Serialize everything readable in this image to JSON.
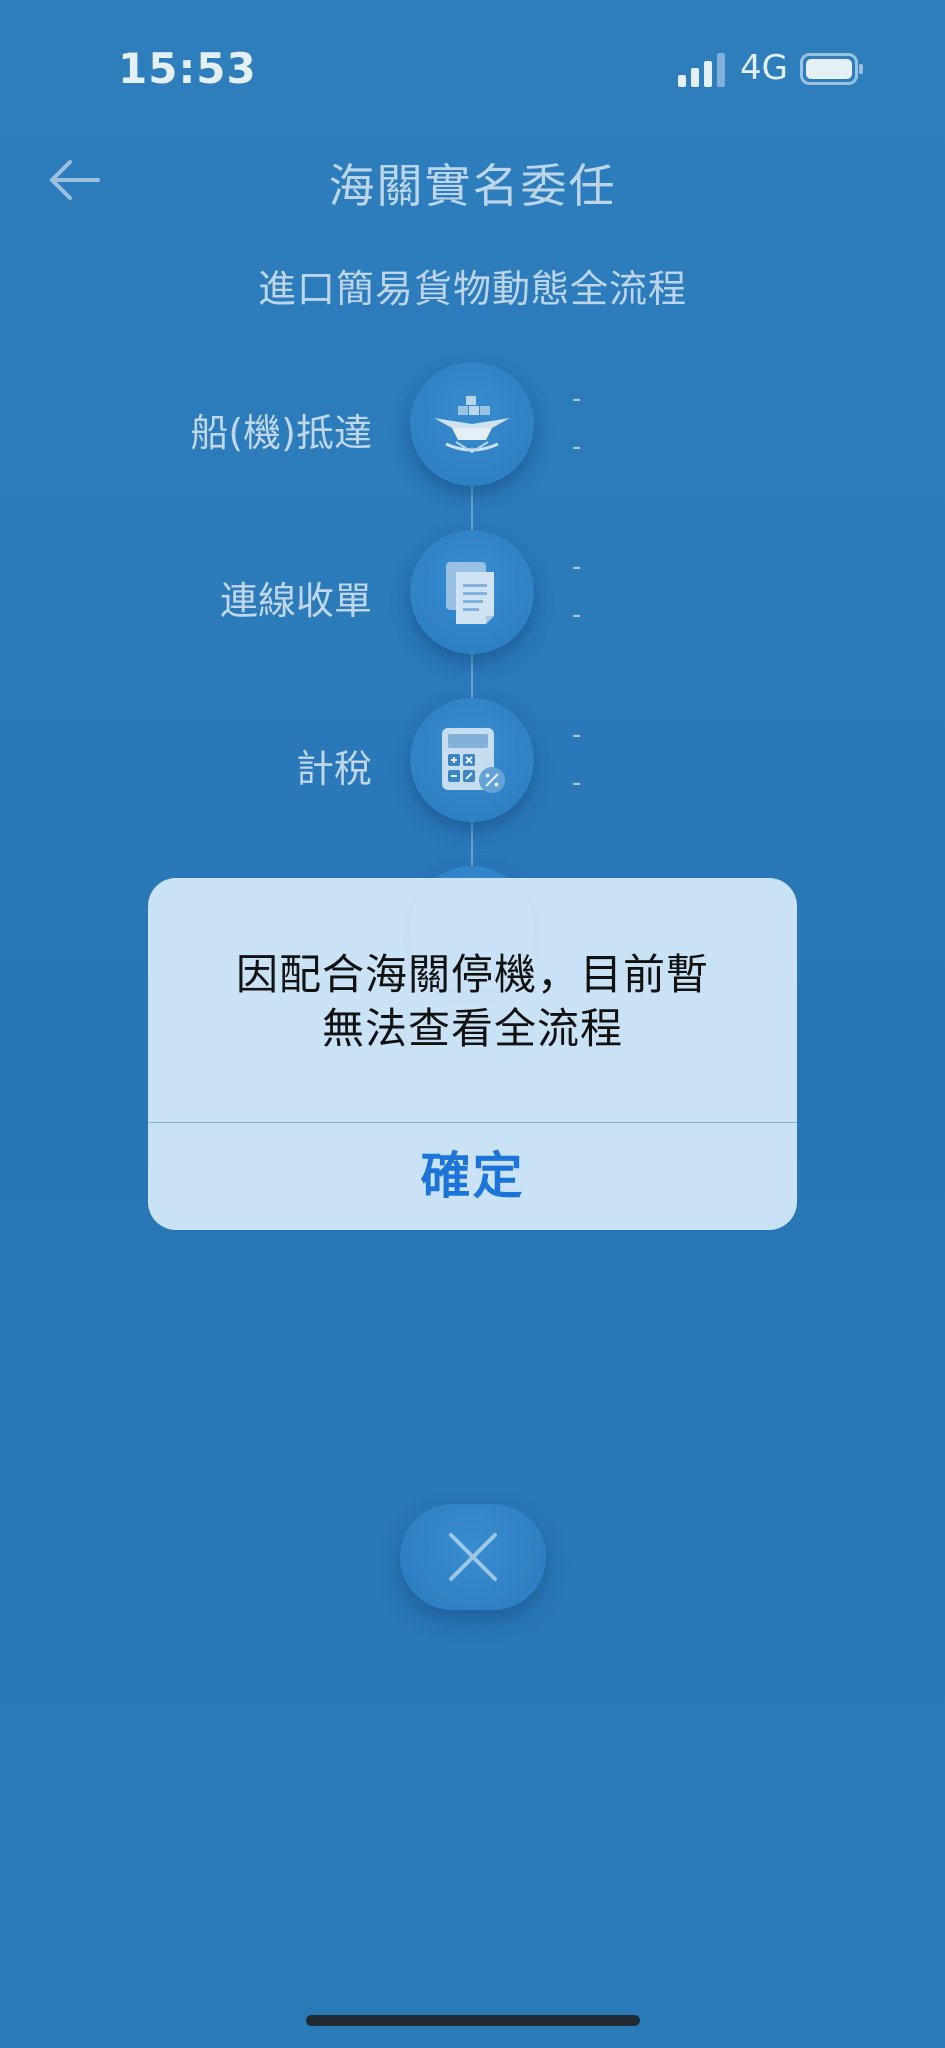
{
  "status_bar": {
    "time": "15:53",
    "network": "4G"
  },
  "header": {
    "title": "海關實名委任"
  },
  "subtitle": "進口簡易貨物動態全流程",
  "timeline": {
    "steps": [
      {
        "label": "船(機)抵達",
        "icon": "ship-plane-icon",
        "line1": "-",
        "line2": "-"
      },
      {
        "label": "連線收單",
        "icon": "document-icon",
        "line1": "-",
        "line2": "-"
      },
      {
        "label": "計稅",
        "icon": "calculator-icon",
        "line1": "-",
        "line2": "-"
      }
    ]
  },
  "dialog": {
    "message_line1": "因配合海關停機，目前暫",
    "message_line2": "無法查看全流程",
    "ok_label": "確定"
  },
  "colors": {
    "background": "#2e7cbc",
    "dialog_bg": "#cee5f8",
    "accent": "#1c74d9"
  }
}
